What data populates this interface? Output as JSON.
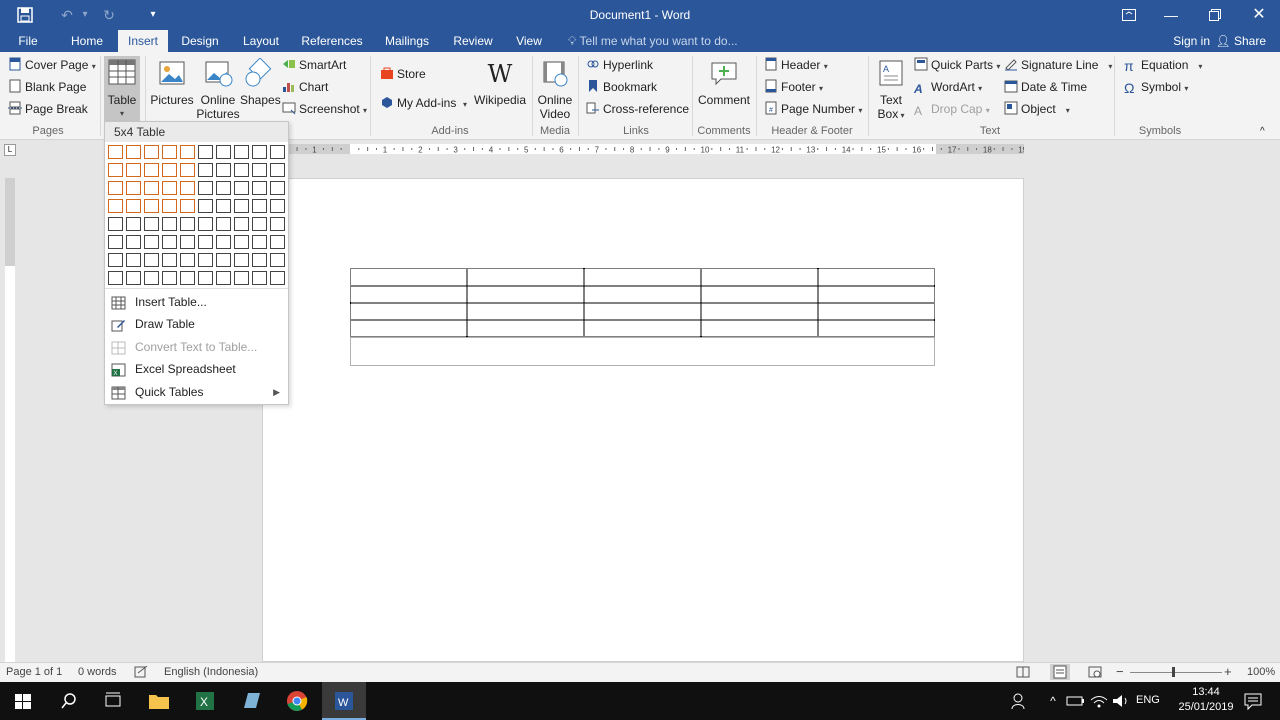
{
  "window": {
    "title": "Document1 - Word"
  },
  "tabs": {
    "file": "File",
    "items": [
      "Home",
      "Insert",
      "Design",
      "Layout",
      "References",
      "Mailings",
      "Review",
      "View"
    ],
    "active": "Insert",
    "tell_me": "Tell me what you want to do...",
    "sign_in": "Sign in",
    "share": "Share"
  },
  "ribbon": {
    "pages": {
      "label": "Pages",
      "cover_page": "Cover Page",
      "blank_page": "Blank Page",
      "page_break": "Page Break"
    },
    "tables": {
      "table": "Table"
    },
    "illustrations": {
      "pictures": "Pictures",
      "online_pictures_1": "Online",
      "online_pictures_2": "Pictures",
      "shapes": "Shapes",
      "smartart": "SmartArt",
      "chart": "Chart",
      "screenshot": "Screenshot"
    },
    "addins": {
      "label": "Add-ins",
      "store": "Store",
      "my_addins": "My Add-ins",
      "wikipedia": "Wikipedia"
    },
    "media": {
      "label": "Media",
      "online_video_1": "Online",
      "online_video_2": "Video"
    },
    "links": {
      "label": "Links",
      "hyperlink": "Hyperlink",
      "bookmark": "Bookmark",
      "cross_reference": "Cross-reference"
    },
    "comments": {
      "label": "Comments",
      "comment": "Comment"
    },
    "header_footer": {
      "label": "Header & Footer",
      "header": "Header",
      "footer": "Footer",
      "page_number": "Page Number"
    },
    "text": {
      "label": "Text",
      "text_box_1": "Text",
      "text_box_2": "Box",
      "quick_parts": "Quick Parts",
      "wordart": "WordArt",
      "drop_cap": "Drop Cap",
      "signature_line": "Signature Line",
      "date_time": "Date & Time",
      "object": "Object"
    },
    "symbols": {
      "label": "Symbols",
      "equation": "Equation",
      "symbol": "Symbol"
    }
  },
  "table_dropdown": {
    "header": "5x4 Table",
    "grid_cols": 10,
    "grid_rows": 8,
    "selected_cols": 5,
    "selected_rows": 4,
    "items": [
      {
        "label": "Insert Table...",
        "disabled": false
      },
      {
        "label": "Draw Table",
        "disabled": false
      },
      {
        "label": "Convert Text to Table...",
        "disabled": true
      },
      {
        "label": "Excel Spreadsheet",
        "disabled": false
      },
      {
        "label": "Quick Tables",
        "disabled": false,
        "submenu": true
      }
    ]
  },
  "document": {
    "table_cols": 5,
    "table_rows": 4
  },
  "statusbar": {
    "page": "Page 1 of 1",
    "words": "0 words",
    "language": "English (Indonesia)",
    "zoom": "100%"
  },
  "taskbar": {
    "language": "ENG",
    "time": "13:44",
    "date": "25/01/2019"
  },
  "colors": {
    "word_blue": "#2b579a",
    "grid_highlight": "#d2691e"
  }
}
